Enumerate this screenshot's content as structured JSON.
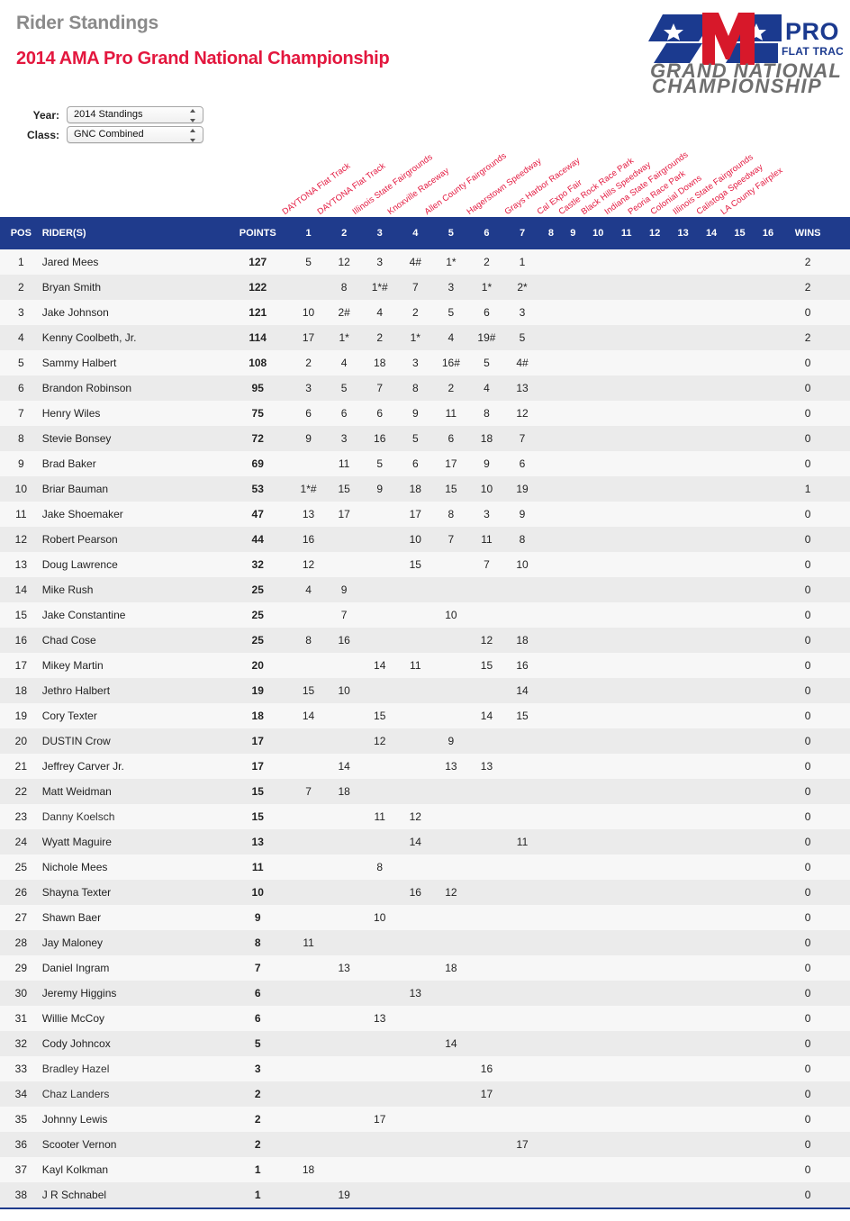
{
  "header": {
    "title": "Rider Standings",
    "subtitle": "2014 AMA Pro Grand National Championship",
    "logo": {
      "ama": "AMA",
      "pro": "PRO",
      "flat_track": "FLAT TRACK",
      "line1": "GRAND NATIONAL",
      "line2": "CHAMPIONSHIP"
    }
  },
  "filters": {
    "year": {
      "label": "Year:",
      "value": "2014 Standings"
    },
    "class": {
      "label": "Class:",
      "value": "GNC Combined"
    }
  },
  "venues": [
    "DAYTONA Flat Track",
    "DAYTONA Flat Track",
    "Illinois State Fairgrounds",
    "Knoxville Raceway",
    "Allen County Fairgrounds",
    "Hagerstown Speedway",
    "Grays Harbor Raceway",
    "Cal Expo Fair",
    "Castle Rock Race Park",
    "Black Hills Speedway",
    "Indiana State Fairgrounds",
    "Peoria Race Park",
    "Colonial Downs",
    "Illinois State Fairgrounds",
    "Calistoga Speedway",
    "LA County Fairplex"
  ],
  "table": {
    "columns": {
      "pos": "POS",
      "rider": "RIDER(S)",
      "points": "POINTS",
      "rounds": [
        "1",
        "2",
        "3",
        "4",
        "5",
        "6",
        "7",
        "8",
        "9",
        "10",
        "11",
        "12",
        "13",
        "14",
        "15",
        "16"
      ],
      "wins": "WINS"
    },
    "rows": [
      {
        "pos": "1",
        "rider": "Jared Mees",
        "link": true,
        "points": "127",
        "rounds": [
          "5",
          "12",
          "3",
          "4#",
          "1*",
          "2",
          "1",
          "",
          "",
          "",
          "",
          "",
          "",
          "",
          "",
          ""
        ],
        "wins": "2"
      },
      {
        "pos": "2",
        "rider": "Bryan Smith",
        "link": true,
        "points": "122",
        "rounds": [
          "",
          "8",
          "1*#",
          "7",
          "3",
          "1*",
          "2*",
          "",
          "",
          "",
          "",
          "",
          "",
          "",
          "",
          ""
        ],
        "wins": "2"
      },
      {
        "pos": "3",
        "rider": "Jake Johnson",
        "link": true,
        "points": "121",
        "rounds": [
          "10",
          "2#",
          "4",
          "2",
          "5",
          "6",
          "3",
          "",
          "",
          "",
          "",
          "",
          "",
          "",
          "",
          ""
        ],
        "wins": "0"
      },
      {
        "pos": "4",
        "rider": "Kenny Coolbeth, Jr.",
        "link": true,
        "points": "114",
        "rounds": [
          "17",
          "1*",
          "2",
          "1*",
          "4",
          "19#",
          "5",
          "",
          "",
          "",
          "",
          "",
          "",
          "",
          "",
          ""
        ],
        "wins": "2"
      },
      {
        "pos": "5",
        "rider": "Sammy Halbert",
        "link": true,
        "points": "108",
        "rounds": [
          "2",
          "4",
          "18",
          "3",
          "16#",
          "5",
          "4#",
          "",
          "",
          "",
          "",
          "",
          "",
          "",
          "",
          ""
        ],
        "wins": "0"
      },
      {
        "pos": "6",
        "rider": "Brandon Robinson",
        "link": true,
        "points": "95",
        "rounds": [
          "3",
          "5",
          "7",
          "8",
          "2",
          "4",
          "13",
          "",
          "",
          "",
          "",
          "",
          "",
          "",
          "",
          ""
        ],
        "wins": "0"
      },
      {
        "pos": "7",
        "rider": "Henry Wiles",
        "link": true,
        "points": "75",
        "rounds": [
          "6",
          "6",
          "6",
          "9",
          "11",
          "8",
          "12",
          "",
          "",
          "",
          "",
          "",
          "",
          "",
          "",
          ""
        ],
        "wins": "0"
      },
      {
        "pos": "8",
        "rider": "Stevie Bonsey",
        "link": true,
        "points": "72",
        "rounds": [
          "9",
          "3",
          "16",
          "5",
          "6",
          "18",
          "7",
          "",
          "",
          "",
          "",
          "",
          "",
          "",
          "",
          ""
        ],
        "wins": "0"
      },
      {
        "pos": "9",
        "rider": "Brad Baker",
        "link": true,
        "points": "69",
        "rounds": [
          "",
          "11",
          "5",
          "6",
          "17",
          "9",
          "6",
          "",
          "",
          "",
          "",
          "",
          "",
          "",
          "",
          ""
        ],
        "wins": "0"
      },
      {
        "pos": "10",
        "rider": "Briar Bauman",
        "link": true,
        "points": "53",
        "rounds": [
          "1*#",
          "15",
          "9",
          "18",
          "15",
          "10",
          "19",
          "",
          "",
          "",
          "",
          "",
          "",
          "",
          "",
          ""
        ],
        "wins": "1"
      },
      {
        "pos": "11",
        "rider": "Jake Shoemaker",
        "link": true,
        "points": "47",
        "rounds": [
          "13",
          "17",
          "",
          "17",
          "8",
          "3",
          "9",
          "",
          "",
          "",
          "",
          "",
          "",
          "",
          "",
          ""
        ],
        "wins": "0"
      },
      {
        "pos": "12",
        "rider": "Robert Pearson",
        "link": true,
        "points": "44",
        "rounds": [
          "16",
          "",
          "",
          "10",
          "7",
          "11",
          "8",
          "",
          "",
          "",
          "",
          "",
          "",
          "",
          "",
          ""
        ],
        "wins": "0"
      },
      {
        "pos": "13",
        "rider": "Doug Lawrence",
        "link": true,
        "points": "32",
        "rounds": [
          "12",
          "",
          "",
          "15",
          "",
          "7",
          "10",
          "",
          "",
          "",
          "",
          "",
          "",
          "",
          "",
          ""
        ],
        "wins": "0"
      },
      {
        "pos": "14",
        "rider": "Mike Rush",
        "link": true,
        "points": "25",
        "rounds": [
          "4",
          "9",
          "",
          "",
          "",
          "",
          "",
          "",
          "",
          "",
          "",
          "",
          "",
          "",
          "",
          ""
        ],
        "wins": "0"
      },
      {
        "pos": "15",
        "rider": "Jake Constantine",
        "link": true,
        "points": "25",
        "rounds": [
          "",
          "7",
          "",
          "",
          "10",
          "",
          "",
          "",
          "",
          "",
          "",
          "",
          "",
          "",
          "",
          ""
        ],
        "wins": "0"
      },
      {
        "pos": "16",
        "rider": "Chad Cose",
        "link": true,
        "points": "25",
        "rounds": [
          "8",
          "16",
          "",
          "",
          "",
          "12",
          "18",
          "",
          "",
          "",
          "",
          "",
          "",
          "",
          "",
          ""
        ],
        "wins": "0"
      },
      {
        "pos": "17",
        "rider": "Mikey Martin",
        "link": true,
        "points": "20",
        "rounds": [
          "",
          "",
          "14",
          "11",
          "",
          "15",
          "16",
          "",
          "",
          "",
          "",
          "",
          "",
          "",
          "",
          ""
        ],
        "wins": "0"
      },
      {
        "pos": "18",
        "rider": "Jethro Halbert",
        "link": true,
        "points": "19",
        "rounds": [
          "15",
          "10",
          "",
          "",
          "",
          "",
          "14",
          "",
          "",
          "",
          "",
          "",
          "",
          "",
          "",
          ""
        ],
        "wins": "0"
      },
      {
        "pos": "19",
        "rider": "Cory Texter",
        "link": true,
        "points": "18",
        "rounds": [
          "14",
          "",
          "15",
          "",
          "",
          "14",
          "15",
          "",
          "",
          "",
          "",
          "",
          "",
          "",
          "",
          ""
        ],
        "wins": "0"
      },
      {
        "pos": "20",
        "rider": "DUSTIN Crow",
        "link": true,
        "points": "17",
        "rounds": [
          "",
          "",
          "12",
          "",
          "9",
          "",
          "",
          "",
          "",
          "",
          "",
          "",
          "",
          "",
          "",
          ""
        ],
        "wins": "0"
      },
      {
        "pos": "21",
        "rider": "Jeffrey Carver Jr.",
        "link": true,
        "points": "17",
        "rounds": [
          "",
          "14",
          "",
          "",
          "13",
          "13",
          "",
          "",
          "",
          "",
          "",
          "",
          "",
          "",
          "",
          ""
        ],
        "wins": "0"
      },
      {
        "pos": "22",
        "rider": "Matt Weidman",
        "link": true,
        "points": "15",
        "rounds": [
          "7",
          "18",
          "",
          "",
          "",
          "",
          "",
          "",
          "",
          "",
          "",
          "",
          "",
          "",
          "",
          ""
        ],
        "wins": "0"
      },
      {
        "pos": "23",
        "rider": "Danny Koelsch",
        "link": false,
        "points": "15",
        "rounds": [
          "",
          "",
          "11",
          "12",
          "",
          "",
          "",
          "",
          "",
          "",
          "",
          "",
          "",
          "",
          "",
          ""
        ],
        "wins": "0"
      },
      {
        "pos": "24",
        "rider": "Wyatt Maguire",
        "link": true,
        "points": "13",
        "rounds": [
          "",
          "",
          "",
          "14",
          "",
          "",
          "11",
          "",
          "",
          "",
          "",
          "",
          "",
          "",
          "",
          ""
        ],
        "wins": "0"
      },
      {
        "pos": "25",
        "rider": "Nichole Mees",
        "link": true,
        "points": "11",
        "rounds": [
          "",
          "",
          "8",
          "",
          "",
          "",
          "",
          "",
          "",
          "",
          "",
          "",
          "",
          "",
          "",
          ""
        ],
        "wins": "0"
      },
      {
        "pos": "26",
        "rider": "Shayna Texter",
        "link": true,
        "points": "10",
        "rounds": [
          "",
          "",
          "",
          "16",
          "12",
          "",
          "",
          "",
          "",
          "",
          "",
          "",
          "",
          "",
          "",
          ""
        ],
        "wins": "0"
      },
      {
        "pos": "27",
        "rider": "Shawn Baer",
        "link": true,
        "points": "9",
        "rounds": [
          "",
          "",
          "10",
          "",
          "",
          "",
          "",
          "",
          "",
          "",
          "",
          "",
          "",
          "",
          "",
          ""
        ],
        "wins": "0"
      },
      {
        "pos": "28",
        "rider": "Jay Maloney",
        "link": true,
        "points": "8",
        "rounds": [
          "11",
          "",
          "",
          "",
          "",
          "",
          "",
          "",
          "",
          "",
          "",
          "",
          "",
          "",
          "",
          ""
        ],
        "wins": "0"
      },
      {
        "pos": "29",
        "rider": "Daniel Ingram",
        "link": true,
        "points": "7",
        "rounds": [
          "",
          "13",
          "",
          "",
          "18",
          "",
          "",
          "",
          "",
          "",
          "",
          "",
          "",
          "",
          "",
          ""
        ],
        "wins": "0"
      },
      {
        "pos": "30",
        "rider": "Jeremy Higgins",
        "link": true,
        "points": "6",
        "rounds": [
          "",
          "",
          "",
          "13",
          "",
          "",
          "",
          "",
          "",
          "",
          "",
          "",
          "",
          "",
          "",
          ""
        ],
        "wins": "0"
      },
      {
        "pos": "31",
        "rider": "Willie McCoy",
        "link": true,
        "points": "6",
        "rounds": [
          "",
          "",
          "13",
          "",
          "",
          "",
          "",
          "",
          "",
          "",
          "",
          "",
          "",
          "",
          "",
          ""
        ],
        "wins": "0"
      },
      {
        "pos": "32",
        "rider": "Cody Johncox",
        "link": true,
        "points": "5",
        "rounds": [
          "",
          "",
          "",
          "",
          "14",
          "",
          "",
          "",
          "",
          "",
          "",
          "",
          "",
          "",
          "",
          ""
        ],
        "wins": "0"
      },
      {
        "pos": "33",
        "rider": "Bradley Hazel",
        "link": false,
        "points": "3",
        "rounds": [
          "",
          "",
          "",
          "",
          "",
          "16",
          "",
          "",
          "",
          "",
          "",
          "",
          "",
          "",
          "",
          ""
        ],
        "wins": "0"
      },
      {
        "pos": "34",
        "rider": "Chaz Landers",
        "link": false,
        "points": "2",
        "rounds": [
          "",
          "",
          "",
          "",
          "",
          "17",
          "",
          "",
          "",
          "",
          "",
          "",
          "",
          "",
          "",
          ""
        ],
        "wins": "0"
      },
      {
        "pos": "35",
        "rider": "Johnny Lewis",
        "link": true,
        "points": "2",
        "rounds": [
          "",
          "",
          "17",
          "",
          "",
          "",
          "",
          "",
          "",
          "",
          "",
          "",
          "",
          "",
          "",
          ""
        ],
        "wins": "0"
      },
      {
        "pos": "36",
        "rider": "Scooter Vernon",
        "link": true,
        "points": "2",
        "rounds": [
          "",
          "",
          "",
          "",
          "",
          "",
          "17",
          "",
          "",
          "",
          "",
          "",
          "",
          "",
          "",
          ""
        ],
        "wins": "0"
      },
      {
        "pos": "37",
        "rider": "Kayl Kolkman",
        "link": true,
        "points": "1",
        "rounds": [
          "18",
          "",
          "",
          "",
          "",
          "",
          "",
          "",
          "",
          "",
          "",
          "",
          "",
          "",
          "",
          ""
        ],
        "wins": "0"
      },
      {
        "pos": "38",
        "rider": "J R Schnabel",
        "link": true,
        "points": "1",
        "rounds": [
          "",
          "19",
          "",
          "",
          "",
          "",
          "",
          "",
          "",
          "",
          "",
          "",
          "",
          "",
          "",
          ""
        ],
        "wins": "0"
      }
    ]
  },
  "colors": {
    "header_blue": "#1f3b8c",
    "accent_red": "#e3173e",
    "title_gray": "#8a8a8a"
  }
}
